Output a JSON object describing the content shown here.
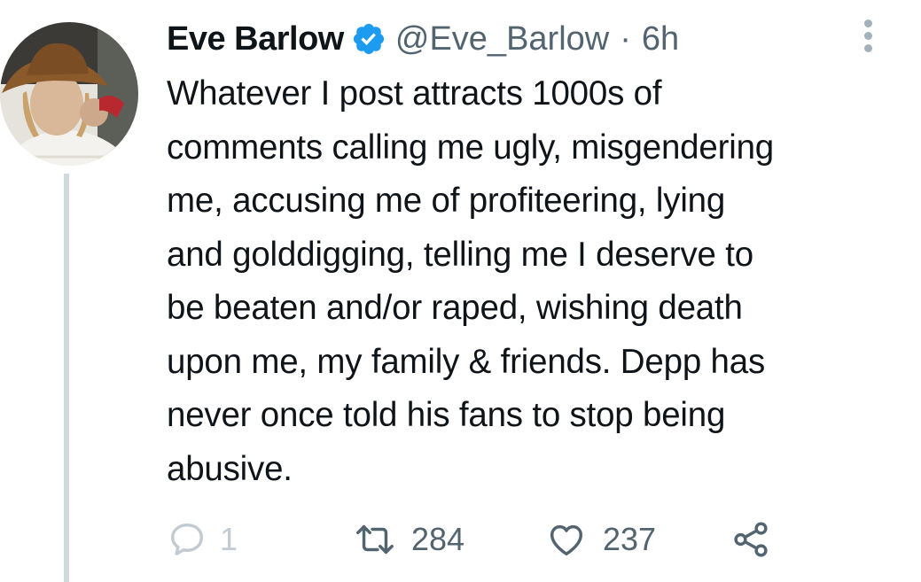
{
  "tweet": {
    "author_name": "Eve Barlow",
    "handle": "@Eve_Barlow",
    "separator": "·",
    "time": "6h",
    "text": "Whatever I post attracts 1000s of\ncomments calling me ugly, misgendering\nme, accusing me of profiteering, lying\nand golddigging, telling me I deserve to\nbe beaten and/or raped, wishing death\nupon me, my family & friends. Depp has\nnever once told his fans to stop being\nabusive."
  },
  "actions": {
    "reply_count": "1",
    "retweet_count": "284",
    "like_count": "237"
  },
  "icons": {
    "reply": "speech-bubble-icon",
    "retweet": "retweet-arrows-icon",
    "like": "heart-outline-icon",
    "share": "share-nodes-icon",
    "verified": "verified-badge-icon",
    "more": "vertical-dots-icon"
  },
  "colors": {
    "verified_badge": "#1d9bf0",
    "secondary_text": "#536471",
    "thread_line": "#cfd9de"
  }
}
